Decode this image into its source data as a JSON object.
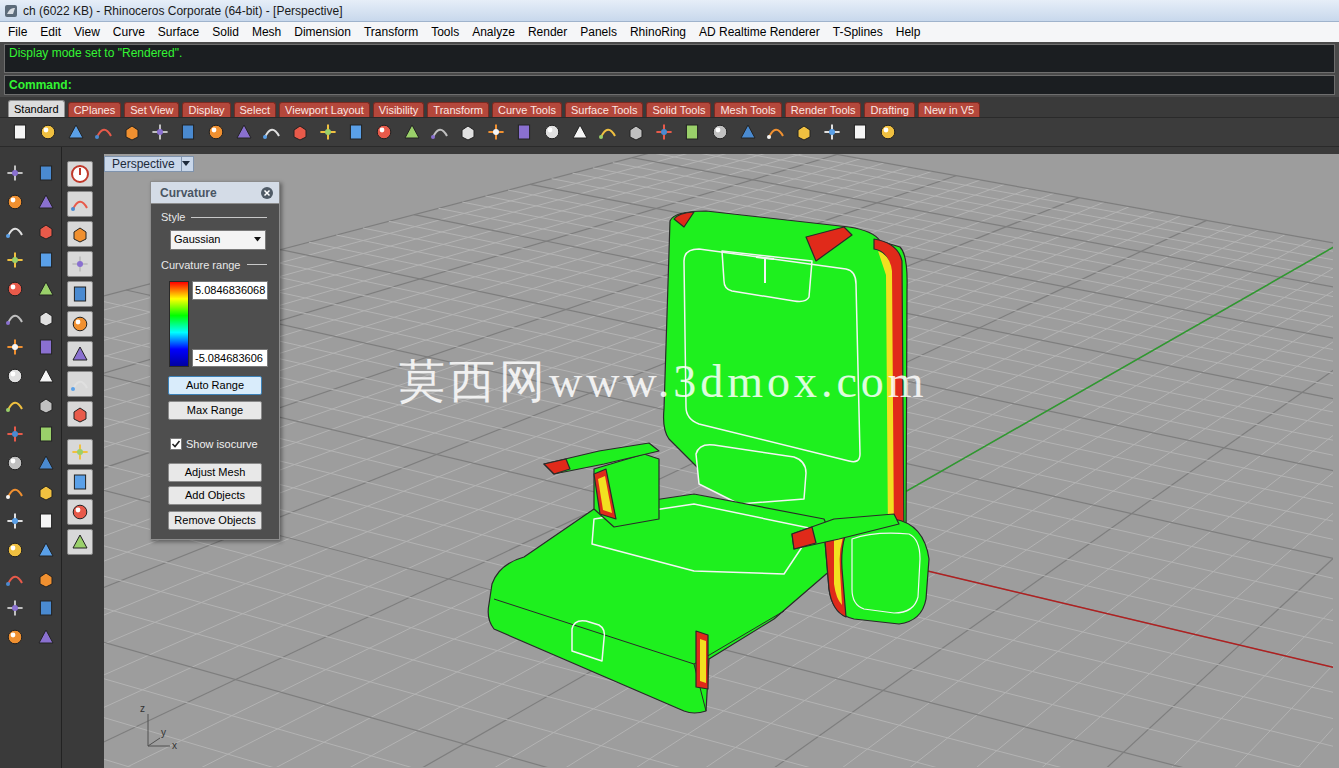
{
  "window": {
    "title": "ch (6022 KB) - Rhinoceros Corporate (64-bit) - [Perspective]"
  },
  "menu": [
    "File",
    "Edit",
    "View",
    "Curve",
    "Surface",
    "Solid",
    "Mesh",
    "Dimension",
    "Transform",
    "Tools",
    "Analyze",
    "Render",
    "Panels",
    "RhinoRing",
    "AD Realtime Renderer",
    "T-Splines",
    "Help"
  ],
  "command": {
    "history": "Display mode set to \"Rendered\".",
    "prompt": "Command:"
  },
  "toolbar_tabs": [
    {
      "label": "Standard",
      "selected": true
    },
    {
      "label": "CPlanes",
      "selected": false
    },
    {
      "label": "Set View",
      "selected": false
    },
    {
      "label": "Display",
      "selected": false
    },
    {
      "label": "Select",
      "selected": false
    },
    {
      "label": "Viewport Layout",
      "selected": false
    },
    {
      "label": "Visibility",
      "selected": false
    },
    {
      "label": "Transform",
      "selected": false
    },
    {
      "label": "Curve Tools",
      "selected": false
    },
    {
      "label": "Surface Tools",
      "selected": false
    },
    {
      "label": "Solid Tools",
      "selected": false
    },
    {
      "label": "Mesh Tools",
      "selected": false
    },
    {
      "label": "Render Tools",
      "selected": false
    },
    {
      "label": "Drafting",
      "selected": false
    },
    {
      "label": "New in V5",
      "selected": false
    }
  ],
  "viewport": {
    "label": "Perspective"
  },
  "curvature_panel": {
    "title": "Curvature",
    "style_label": "Style",
    "style_value": "Gaussian",
    "range_label": "Curvature range",
    "max": "5.0846836068",
    "min": "-5.084683606",
    "range_buttons": [
      {
        "label": "Auto Range",
        "selected": true
      },
      {
        "label": "Max Range",
        "selected": false
      }
    ],
    "show_isocurve": {
      "label": "Show isocurve",
      "checked": true
    },
    "actions": [
      "Adjust Mesh",
      "Add Objects",
      "Remove Objects"
    ]
  },
  "watermark": "莫西网www.3dmox.com",
  "axes": [
    "z",
    "y",
    "x"
  ]
}
